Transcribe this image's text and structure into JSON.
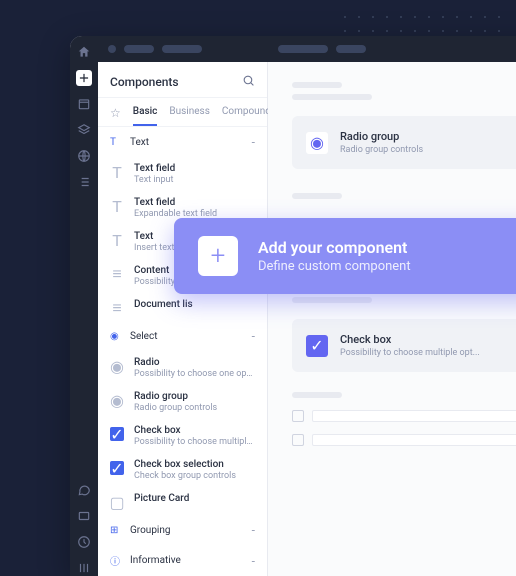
{
  "sidebar": {
    "title": "Components",
    "tabs": [
      "Basic",
      "Business",
      "Compound"
    ],
    "activeTab": 0,
    "sections": {
      "text": {
        "label": "Text"
      },
      "select": {
        "label": "Select"
      },
      "grouping": {
        "label": "Grouping"
      },
      "informative": {
        "label": "Informative"
      }
    },
    "textItems": [
      {
        "name": "Text field",
        "sub": "Text input"
      },
      {
        "name": "Text field",
        "sub": "Expandable text field"
      },
      {
        "name": "Text",
        "sub": "Insert text"
      },
      {
        "name": "Content",
        "sub": "Possibility to"
      },
      {
        "name": "Document lis"
      }
    ],
    "selectItems": [
      {
        "name": "Radio",
        "sub": "Possibility to choose one option..."
      },
      {
        "name": "Radio group",
        "sub": "Radio group controls"
      },
      {
        "name": "Check box",
        "sub": "Possibility to choose multiple opt...",
        "checked": true
      },
      {
        "name": "Check box selection",
        "sub": "Check box group controls",
        "checked": true
      },
      {
        "name": "Picture Card",
        "sub": ""
      }
    ]
  },
  "cards": {
    "radio": {
      "title": "Radio group",
      "sub": "Radio group controls"
    },
    "checkbox": {
      "title": "Check box",
      "sub": "Possibility to choose multiple opt..."
    }
  },
  "overlay": {
    "title": "Add your component",
    "sub": "Define custom component"
  }
}
